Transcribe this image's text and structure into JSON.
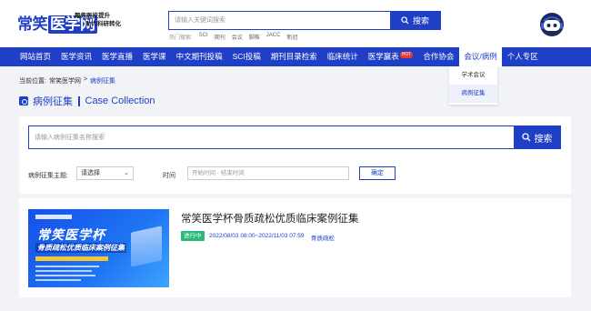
{
  "header": {
    "logo_part1": "常笑",
    "logo_part2": "医学网",
    "slogan_line1": "聚焦医技提升",
    "slogan_line2": "助力科研转化",
    "search_placeholder": "请输入关键词搜索",
    "search_button": "搜索",
    "hot_label": "热门搜索:",
    "hot_keywords": [
      "SCI",
      "期刊",
      "会议",
      "脚椎",
      "JACC",
      "新冠"
    ]
  },
  "nav": {
    "items": [
      {
        "label": "网站首页"
      },
      {
        "label": "医学资讯"
      },
      {
        "label": "医学直播"
      },
      {
        "label": "医学课"
      },
      {
        "label": "中文期刊投稿"
      },
      {
        "label": "SCI投稿"
      },
      {
        "label": "期刊目录检索"
      },
      {
        "label": "临床统计"
      },
      {
        "label": "医学赢表"
      },
      {
        "label": "合作协会"
      },
      {
        "label": "会议/病例"
      },
      {
        "label": "个人专区"
      }
    ],
    "hot_badge": "HOT",
    "dropdown": [
      "学术会议",
      "病例征集"
    ]
  },
  "breadcrumb": {
    "prefix": "当前位置:",
    "home": "常笑医学网",
    "sep": ">",
    "current": "病例征集"
  },
  "section": {
    "title_cn": "病例征集",
    "title_en": "Case Collection"
  },
  "filter": {
    "search_placeholder": "请输入病例征集名称搜索",
    "search_button": "搜索",
    "theme_label": "病例征集主题:",
    "theme_value": "请选择",
    "time_label": "时间",
    "time_placeholder": "开始时间 - 结束时间",
    "confirm_button": "确定"
  },
  "case": {
    "thumb_title": "常笑医学杯",
    "thumb_subtitle": "骨质疏松优质临床案例征集",
    "title": "常笑医学杯骨质疏松优质临床案例征集",
    "status": "进行中",
    "date": "2022/08/03 08:00~2022/11/03 07:59",
    "tag": "骨质疏松"
  },
  "colors": {
    "primary": "#1f3fc7",
    "status_green": "#27b87a",
    "hot_red": "#e53935"
  }
}
